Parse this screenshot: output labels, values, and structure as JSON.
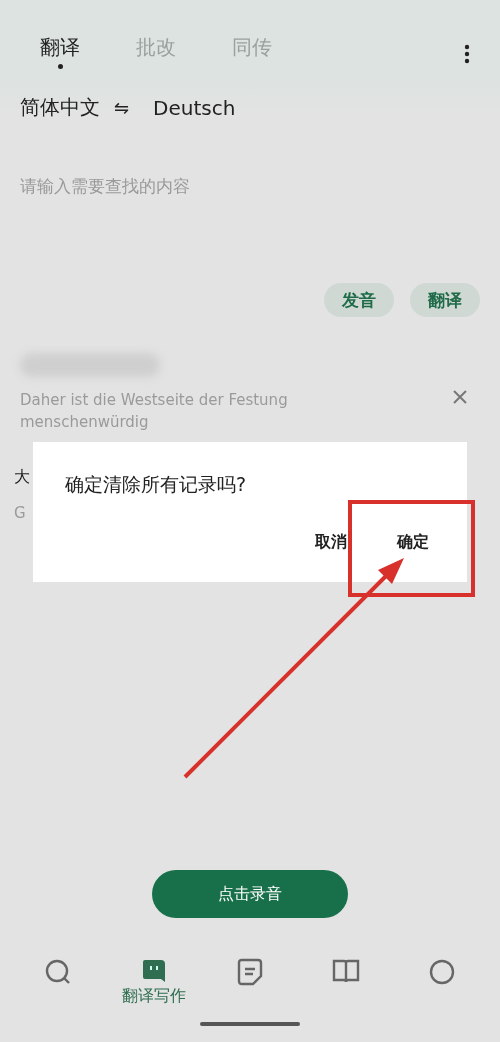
{
  "tabs": [
    {
      "label": "翻译",
      "selected": true
    },
    {
      "label": "批改",
      "selected": false
    },
    {
      "label": "同传",
      "selected": false
    }
  ],
  "languages": {
    "source": "简体中文",
    "swap": "⇋",
    "target": "Deutsch"
  },
  "input": {
    "placeholder": "请输入需要查找的内容"
  },
  "actions": [
    "发音",
    "翻译"
  ],
  "history": [
    {
      "source": "Daher ist die Westseite der Festung menschenwürdig",
      "blurred": true,
      "closable": true
    },
    {
      "title": "大",
      "subtitle": "G",
      "blurred": false,
      "closable": false
    }
  ],
  "dialog": {
    "message": "确定清除所有记录吗?",
    "buttons": [
      "取消",
      "确定"
    ]
  },
  "record_button": "点击录音",
  "bottom_nav": [
    {
      "selected": false
    },
    {
      "label": "翻译写作",
      "selected": true
    },
    {
      "selected": false
    },
    {
      "selected": false
    },
    {
      "selected": false
    }
  ]
}
